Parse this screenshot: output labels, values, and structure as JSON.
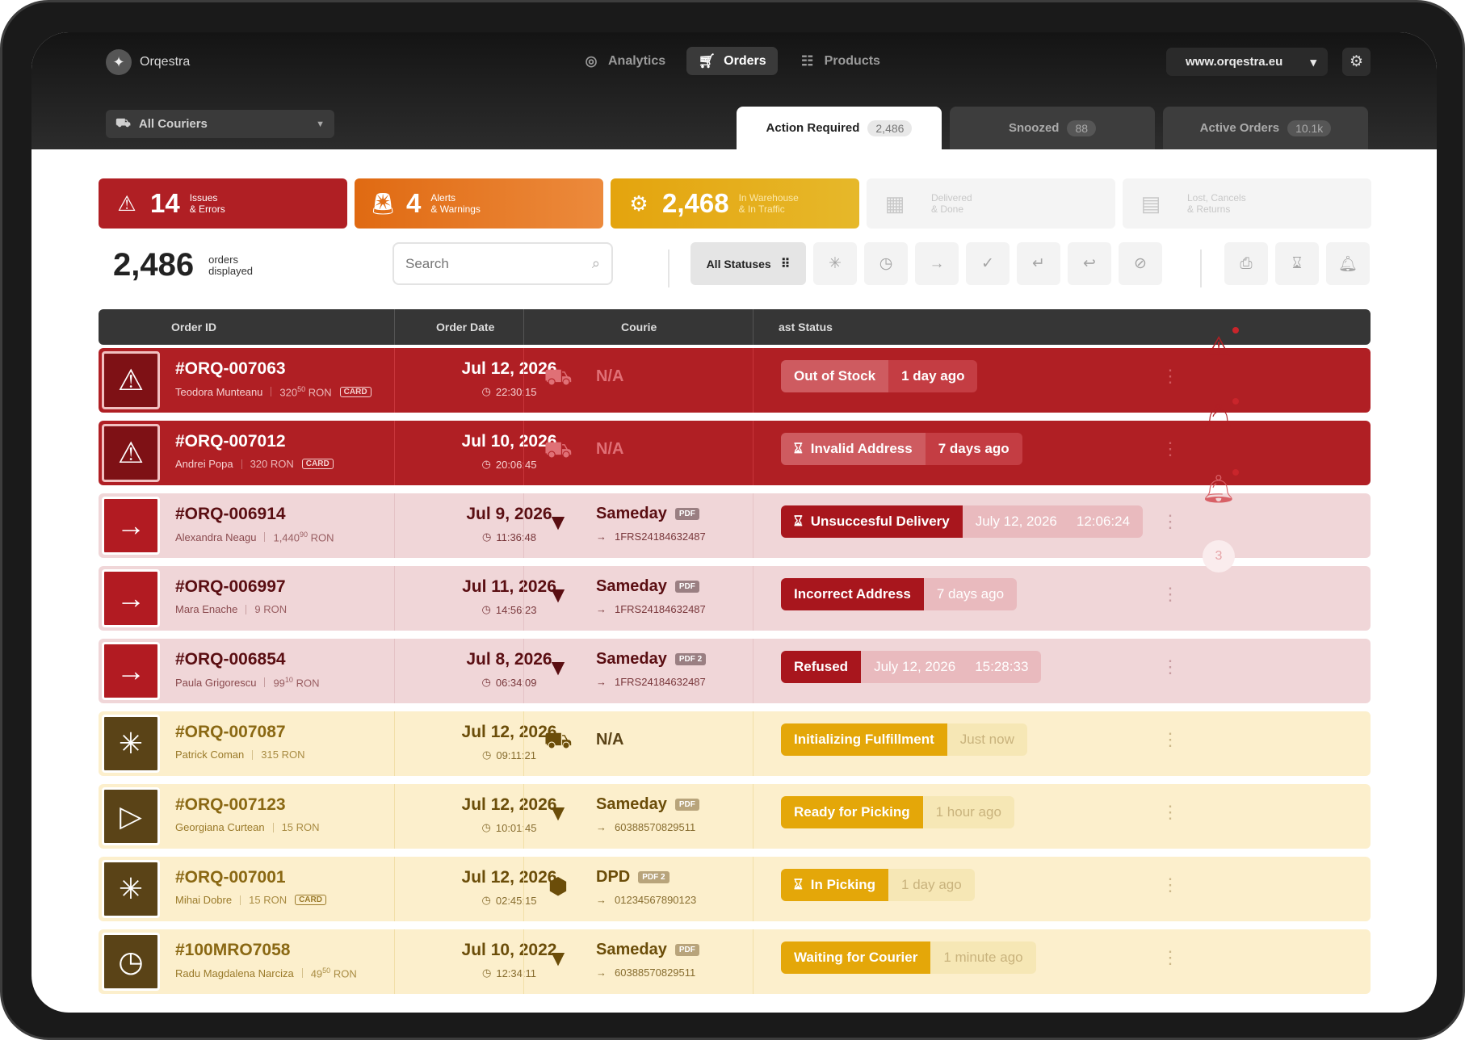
{
  "app": {
    "name": "Orqestra",
    "logo_icon": "sparkle-icon"
  },
  "nav": [
    {
      "label": "Analytics",
      "icon": "gauge-icon",
      "active": false
    },
    {
      "label": "Orders",
      "icon": "cart-icon",
      "active": true
    },
    {
      "label": "Products",
      "icon": "list-icon",
      "active": false
    }
  ],
  "domain_select": {
    "value": "www.orqestra.eu"
  },
  "couriers_filter": {
    "value": "All Couriers"
  },
  "tabs": [
    {
      "label": "Action Required",
      "count": "2,486",
      "active": true
    },
    {
      "label": "Snoozed",
      "count": "88",
      "active": false
    },
    {
      "label": "Active Orders",
      "count": "10.1k",
      "active": false
    }
  ],
  "summary": [
    {
      "number": "14",
      "line1": "Issues",
      "line2": "& Errors",
      "color": "#b01f24"
    },
    {
      "number": "4",
      "line1": "Alerts",
      "line2": "& Warnings",
      "color": "#e06a12"
    },
    {
      "number": "2,468",
      "line1": "In Warehouse",
      "line2": "& In Traffic",
      "color": "#e4a40e"
    },
    {
      "number": "",
      "line1": "Delivered",
      "line2": "& Done",
      "color": "#f4f4f4"
    },
    {
      "number": "",
      "line1": "Lost, Cancels",
      "line2": "& Returns",
      "color": "#f4f4f4"
    }
  ],
  "orders_count": {
    "number": "2,486",
    "line1": "orders",
    "line2": "displayed"
  },
  "search": {
    "placeholder": "Search",
    "value": ""
  },
  "status_filter": {
    "label": "All Statuses"
  },
  "table": {
    "columns": [
      "Order ID",
      "Order Date",
      "Courie",
      "ast Status"
    ],
    "rows": [
      {
        "tone": "red",
        "id": "#ORQ-007063",
        "customer": "Teodora Munteanu",
        "amount": "320",
        "cents": "50",
        "currency": "RON",
        "card": "CARD",
        "date": "Jul 12, 2026",
        "time": "22:30:15",
        "courier": "N/A",
        "pdf": "",
        "pdf_count": "",
        "tracking": "",
        "status": "Out of Stock",
        "status_icon": "",
        "status_time": "1 day ago",
        "status_time2": ""
      },
      {
        "tone": "red",
        "id": "#ORQ-007012",
        "customer": "Andrei Popa",
        "amount": "320",
        "cents": "",
        "currency": "RON",
        "card": "CARD",
        "date": "Jul 10, 2026",
        "time": "20:06:45",
        "courier": "N/A",
        "pdf": "",
        "pdf_count": "",
        "tracking": "",
        "status": "Invalid Address",
        "status_icon": "hourglass",
        "status_time": "7 days ago",
        "status_time2": ""
      },
      {
        "tone": "pink",
        "id": "#ORQ-006914",
        "customer": "Alexandra Neagu",
        "amount": "1,440",
        "cents": "90",
        "currency": "RON",
        "card": "",
        "date": "Jul 9, 2026",
        "time": "11:36:48",
        "courier": "Sameday",
        "pdf": "PDF",
        "pdf_count": "",
        "tracking": "1FRS24184632487",
        "status": "Unsuccesful Delivery",
        "status_icon": "hourglass",
        "status_time": "July 12, 2026",
        "status_time2": "12:06:24"
      },
      {
        "tone": "pink",
        "id": "#ORQ-006997",
        "customer": "Mara Enache",
        "amount": "9",
        "cents": "",
        "currency": "RON",
        "card": "",
        "date": "Jul 11, 2026",
        "time": "14:56:23",
        "courier": "Sameday",
        "pdf": "PDF",
        "pdf_count": "",
        "tracking": "1FRS24184632487",
        "status": "Incorrect Address",
        "status_icon": "",
        "status_time": "7 days ago",
        "status_time2": ""
      },
      {
        "tone": "pink",
        "id": "#ORQ-006854",
        "customer": "Paula Grigorescu",
        "amount": "99",
        "cents": "10",
        "currency": "RON",
        "card": "",
        "date": "Jul 8, 2026",
        "time": "06:34:09",
        "courier": "Sameday",
        "pdf": "PDF",
        "pdf_count": "2",
        "tracking": "1FRS24184632487",
        "status": "Refused",
        "status_icon": "",
        "status_time": "July 12, 2026",
        "status_time2": "15:28:33"
      },
      {
        "tone": "yellow",
        "id": "#ORQ-007087",
        "customer": "Patrick Coman",
        "amount": "315",
        "cents": "",
        "currency": "RON",
        "card": "",
        "date": "Jul 12, 2026",
        "time": "09:11:21",
        "courier": "N/A",
        "pdf": "",
        "pdf_count": "",
        "tracking": "",
        "status": "Initializing Fulfillment",
        "status_icon": "",
        "status_time": "Just now",
        "status_time2": ""
      },
      {
        "tone": "yellow",
        "id": "#ORQ-007123",
        "customer": "Georgiana Curtean",
        "amount": "15",
        "cents": "",
        "currency": "RON",
        "card": "",
        "date": "Jul 12, 2026",
        "time": "10:01:45",
        "courier": "Sameday",
        "pdf": "PDF",
        "pdf_count": "",
        "tracking": "60388570829511",
        "status": "Ready for Picking",
        "status_icon": "",
        "status_time": "1 hour ago",
        "status_time2": ""
      },
      {
        "tone": "yellow",
        "id": "#ORQ-007001",
        "customer": "Mihai Dobre",
        "amount": "15",
        "cents": "",
        "currency": "RON",
        "card": "CARD",
        "date": "Jul 12, 2026",
        "time": "02:45:15",
        "courier": "DPD",
        "pdf": "PDF",
        "pdf_count": "2",
        "tracking": "01234567890123",
        "status": "In Picking",
        "status_icon": "hourglass",
        "status_time": "1 day ago",
        "status_time2": ""
      },
      {
        "tone": "yellow",
        "id": "#100MRO7058",
        "customer": "Radu Magdalena Narciza",
        "amount": "49",
        "cents": "50",
        "currency": "RON",
        "card": "",
        "date": "Jul 10, 2022",
        "time": "12:34:11",
        "courier": "Sameday",
        "pdf": "PDF",
        "pdf_count": "",
        "tracking": "60388570829511",
        "status": "Waiting for Courier",
        "status_icon": "",
        "status_time": "1 minute ago",
        "status_time2": ""
      }
    ]
  },
  "side_panel": {
    "badge_count": "3"
  }
}
